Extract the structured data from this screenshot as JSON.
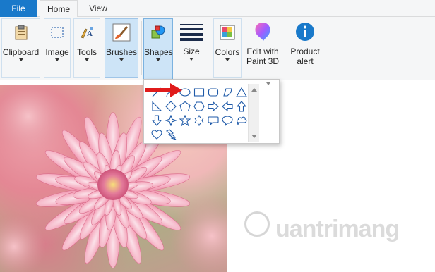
{
  "tabs": {
    "file": "File",
    "home": "Home",
    "view": "View"
  },
  "ribbon": {
    "clipboard": "Clipboard",
    "image": "Image",
    "tools": "Tools",
    "brushes": "Brushes",
    "shapes": "Shapes",
    "size": "Size",
    "colors": "Colors",
    "edit_3d_line1": "Edit with",
    "edit_3d_line2": "Paint 3D",
    "alert_line1": "Product",
    "alert_line2": "alert"
  },
  "icons": {
    "clipboard": "clipboard-icon",
    "image": "select-icon",
    "tools": "tools-icon",
    "brushes": "brush-icon",
    "shapes": "shapes-icon",
    "size": "line-size-icon",
    "colors": "color-palette-icon",
    "paint3d": "paint-3d-icon",
    "alert": "info-icon"
  },
  "shapes": [
    "line",
    "curve",
    "oval",
    "rectangle",
    "rounded-rectangle",
    "polygon",
    "triangle",
    "right-triangle",
    "diamond",
    "pentagon",
    "hexagon",
    "right-arrow",
    "left-arrow",
    "up-arrow",
    "down-arrow",
    "four-point-star",
    "five-point-star",
    "six-point-star",
    "rounded-callout",
    "oval-callout",
    "cloud-callout",
    "heart",
    "lightning"
  ],
  "watermark": {
    "text": "uantrimang"
  },
  "colors": {
    "accent": "#1979ca",
    "shape_stroke": "#1f5aa8",
    "annotation": "#e01b1b"
  }
}
